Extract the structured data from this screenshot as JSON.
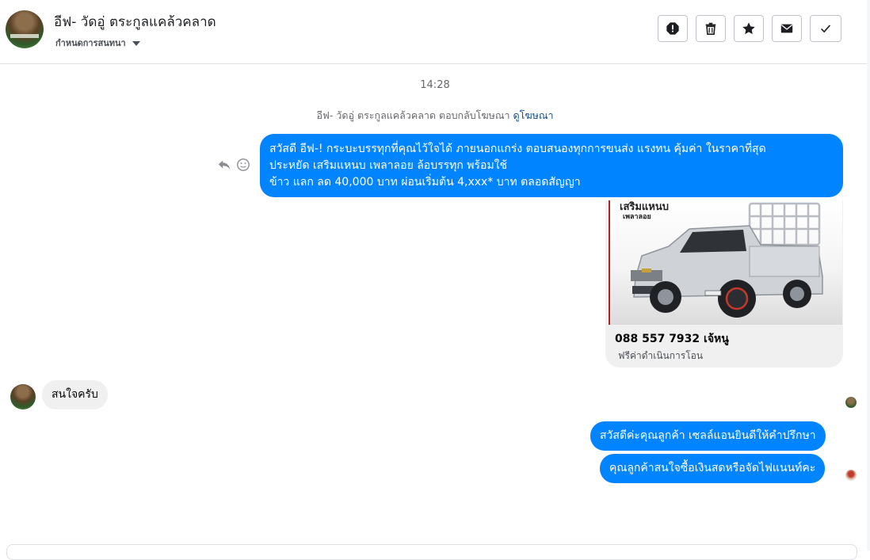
{
  "header": {
    "title": "อีฟ- วัดอู่ ตระกูลแคล้วคลาด",
    "subtitle": "กำหนดการสนทนา",
    "actions": [
      {
        "name": "report-icon"
      },
      {
        "name": "trash-icon"
      },
      {
        "name": "star-icon"
      },
      {
        "name": "envelope-icon"
      },
      {
        "name": "check-icon"
      }
    ]
  },
  "conversation": {
    "timestamp": "14:28",
    "reply_notice": "อีฟ- วัดอู่ ตระกูลแคล้วคลาด ตอบกลับโฆษณา",
    "reply_notice_link": "ดูโฆษณา",
    "ad_message_lines": [
      "สวัสดี อีฟ-! กระบะบรรทุกที่คุณไว้ใจได้ ภายนอกแกร่ง ตอบสนองทุกการขนส่ง แรงทน คุ้มค่า ในราคาที่สุด",
      "ประหยัด เสริมแหนบ เพลาลอย ล้อบรรทุก พร้อมใช้",
      "ข้าว แลก ลด 40,000 บาท ผ่อนเริ่มต้น 4,xxx* บาท ตลอดสัญญา"
    ],
    "ad_card": {
      "image_text_1": "เสริมแหนบ",
      "image_text_2": "เพลาลอย",
      "price_line": "088 557 7932 เจ้หนู",
      "description": "ฟรีค่าดำเนินการโอน"
    },
    "incoming_message": "สนใจครับ",
    "outgoing_messages": [
      "สวัสดีค่ะคุณลูกค้า เซลล์แอนยินดีให้คำปรึกษา",
      "คุณลูกค้าสนใจซื้อเงินสดหรือจัดไฟแนนท์คะ"
    ]
  },
  "colors": {
    "outgoing_bubble": "#0084ff",
    "incoming_bubble": "#f0f0f0",
    "link": "#0a4f8f"
  }
}
